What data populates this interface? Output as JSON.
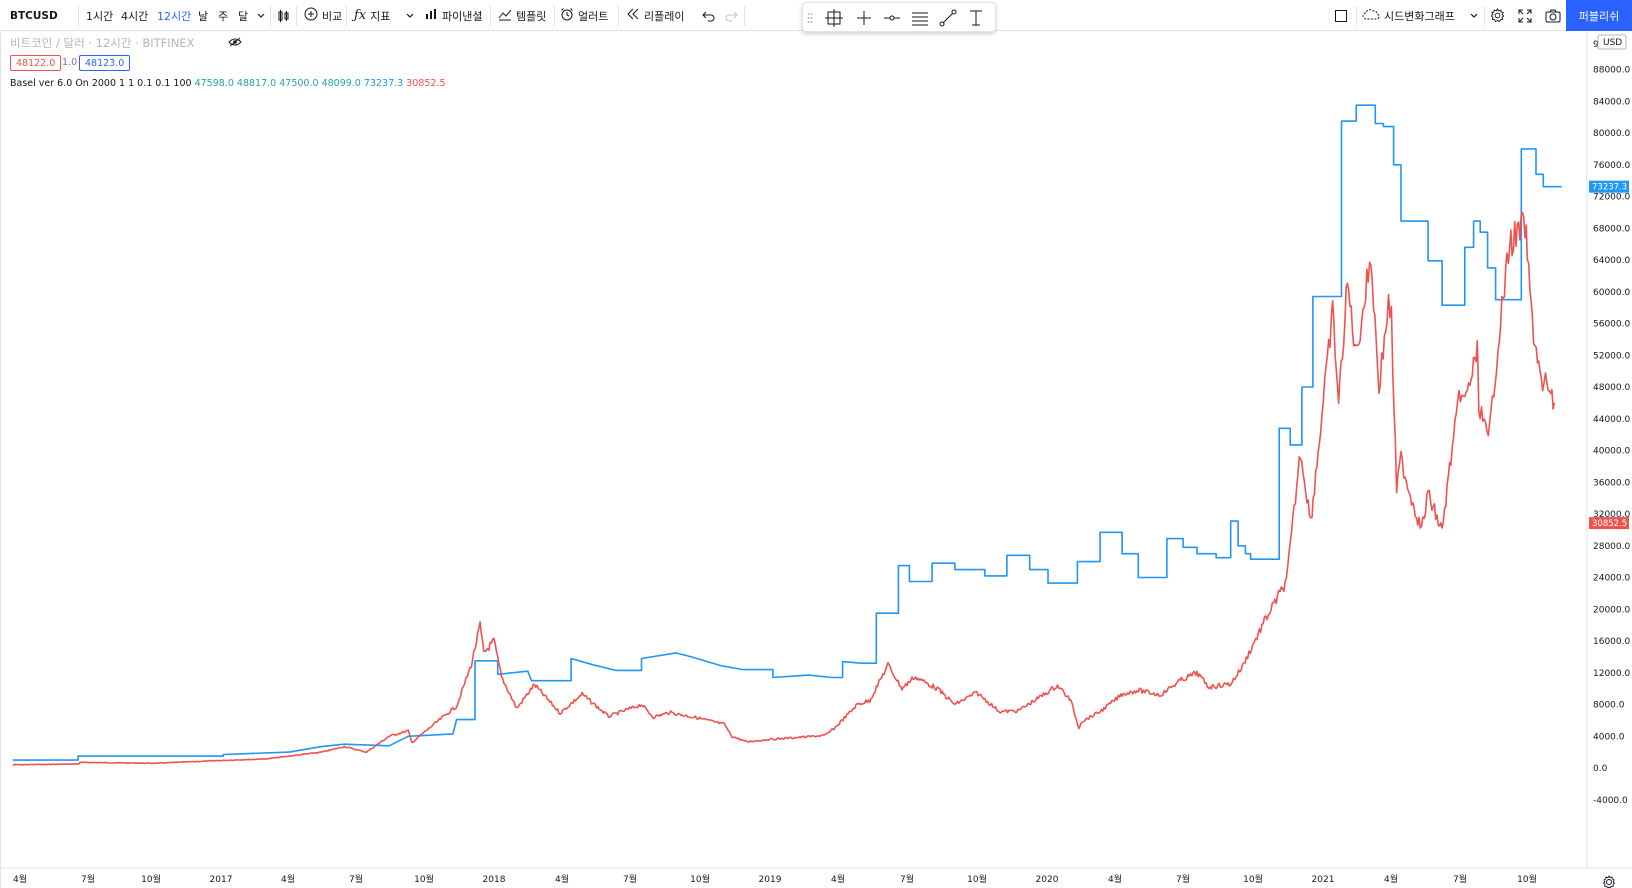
{
  "toolbar": {
    "symbol": "BTCUSD",
    "intervals": [
      "1시간",
      "4시간",
      "12시간",
      "날",
      "주",
      "달"
    ],
    "active_interval": "12시간",
    "compare_label": "비교",
    "indicators_label": "지표",
    "financials_label": "파이낸셜",
    "templates_label": "템플릿",
    "alert_label": "얼러트",
    "replay_label": "리플레이",
    "layout_label": "시드변화그래프",
    "publish_label": "퍼블리쉬"
  },
  "legend": {
    "title": "비트코인 / 달러 · 12시간 · BITFINEX",
    "bid": "48122.0",
    "spread": "1.0",
    "ask": "48123.0"
  },
  "indicator": {
    "name": "Basel ver 6.0 On 2000 1 1 0.1 0.1 100",
    "o": "47598.0",
    "h": "48817.0",
    "l": "47500.0",
    "c": "48099.0",
    "v1": "73237.3",
    "v2": "30852.5"
  },
  "axis": {
    "currency": "USD",
    "top_partial_tick": "9",
    "y_ticks": [
      "88000.0",
      "84000.0",
      "80000.0",
      "76000.0",
      "72000.0",
      "68000.0",
      "64000.0",
      "60000.0",
      "56000.0",
      "52000.0",
      "48000.0",
      "44000.0",
      "40000.0",
      "36000.0",
      "32000.0",
      "28000.0",
      "24000.0",
      "20000.0",
      "16000.0",
      "12000.0",
      "8000.0",
      "4000.0",
      "0.0",
      "-4000.0"
    ],
    "x_ticks": [
      "4월",
      "7월",
      "10월",
      "2017",
      "4월",
      "7월",
      "10월",
      "2018",
      "4월",
      "7월",
      "10월",
      "2019",
      "4월",
      "7월",
      "10월",
      "2020",
      "4월",
      "7월",
      "10월",
      "2021",
      "4월",
      "7월",
      "10월"
    ]
  },
  "labels": {
    "blue_last": "73237.3",
    "red_last": "30852.5"
  },
  "colors": {
    "blue_series": "#2196f3",
    "red_series": "#ef5350",
    "accent": "#2962ff",
    "green_values": "#26a69a"
  },
  "icons": [
    "candles-icon",
    "plus-circle-icon",
    "fx-icon",
    "chart-icon",
    "templates-icon",
    "alarm-icon",
    "replay-icon",
    "undo-icon",
    "redo-icon",
    "square-icon",
    "cloud-icon",
    "gear-icon",
    "fullscreen-icon",
    "camera-icon",
    "eye-off-icon"
  ],
  "chart_data": {
    "type": "line",
    "ylim": [
      -6400,
      93000
    ],
    "x_axis": "time (2016-04 to 2021-12)",
    "series": [
      {
        "color": "#2196f3",
        "shape": "step",
        "points": [
          [
            "2016-03-20",
            1000
          ],
          [
            "2016-06-17",
            1000
          ],
          [
            "2016-06-17",
            1500
          ],
          [
            "2017-01-01",
            1500
          ],
          [
            "2017-01-01",
            1700
          ],
          [
            "2017-04-01",
            2000
          ],
          [
            "2017-05-15",
            2700
          ],
          [
            "2017-06-15",
            3000
          ],
          [
            "2017-08-15",
            2800
          ],
          [
            "2017-09-10",
            4000
          ],
          [
            "2017-11-10",
            4300
          ],
          [
            "2017-11-15",
            6100
          ],
          [
            "2017-12-10",
            6100
          ],
          [
            "2017-12-10",
            13500
          ],
          [
            "2018-01-10",
            13500
          ],
          [
            "2018-01-10",
            11800
          ],
          [
            "2018-02-20",
            12200
          ],
          [
            "2018-02-25",
            11000
          ],
          [
            "2018-04-20",
            11000
          ],
          [
            "2018-04-20",
            13800
          ],
          [
            "2018-05-20",
            13000
          ],
          [
            "2018-06-20",
            12300
          ],
          [
            "2018-07-25",
            12300
          ],
          [
            "2018-07-25",
            13800
          ],
          [
            "2018-09-10",
            14500
          ],
          [
            "2018-10-01",
            14000
          ],
          [
            "2018-11-10",
            12900
          ],
          [
            "2018-12-10",
            12400
          ],
          [
            "2019-01-20",
            12400
          ],
          [
            "2019-01-20",
            11400
          ],
          [
            "2019-03-10",
            11700
          ],
          [
            "2019-04-10",
            11400
          ],
          [
            "2019-04-25",
            11400
          ],
          [
            "2019-04-25",
            13400
          ],
          [
            "2019-05-20",
            13200
          ],
          [
            "2019-06-10",
            13200
          ],
          [
            "2019-06-10",
            19500
          ],
          [
            "2019-07-10",
            19500
          ],
          [
            "2019-07-10",
            25500
          ],
          [
            "2019-07-25",
            25500
          ],
          [
            "2019-07-25",
            23500
          ],
          [
            "2019-08-25",
            23500
          ],
          [
            "2019-08-25",
            25800
          ],
          [
            "2019-09-25",
            25800
          ],
          [
            "2019-09-25",
            25000
          ],
          [
            "2019-11-05",
            25000
          ],
          [
            "2019-11-05",
            24200
          ],
          [
            "2019-12-05",
            24200
          ],
          [
            "2019-12-05",
            26800
          ],
          [
            "2020-01-05",
            26800
          ],
          [
            "2020-01-05",
            25000
          ],
          [
            "2020-01-30",
            25000
          ],
          [
            "2020-01-30",
            23300
          ],
          [
            "2020-03-10",
            23300
          ],
          [
            "2020-03-10",
            26000
          ],
          [
            "2020-04-10",
            26000
          ],
          [
            "2020-04-10",
            29700
          ],
          [
            "2020-05-10",
            29700
          ],
          [
            "2020-05-10",
            27000
          ],
          [
            "2020-06-01",
            27000
          ],
          [
            "2020-06-01",
            24000
          ],
          [
            "2020-07-10",
            24000
          ],
          [
            "2020-07-10",
            28900
          ],
          [
            "2020-08-01",
            28900
          ],
          [
            "2020-08-01",
            27800
          ],
          [
            "2020-08-20",
            27800
          ],
          [
            "2020-08-20",
            27000
          ],
          [
            "2020-09-15",
            27000
          ],
          [
            "2020-09-15",
            26500
          ],
          [
            "2020-10-05",
            26500
          ],
          [
            "2020-10-05",
            31100
          ],
          [
            "2020-10-15",
            31100
          ],
          [
            "2020-10-15",
            28000
          ],
          [
            "2020-10-25",
            28000
          ],
          [
            "2020-10-25",
            27000
          ],
          [
            "2020-11-01",
            27000
          ],
          [
            "2020-11-01",
            26300
          ],
          [
            "2020-12-10",
            26300
          ],
          [
            "2020-12-10",
            42800
          ],
          [
            "2020-12-25",
            42800
          ],
          [
            "2020-12-25",
            40700
          ],
          [
            "2021-01-10",
            40700
          ],
          [
            "2021-01-10",
            48000
          ],
          [
            "2021-01-25",
            48000
          ],
          [
            "2021-01-25",
            59400
          ],
          [
            "2021-03-05",
            59400
          ],
          [
            "2021-03-05",
            81500
          ],
          [
            "2021-03-25",
            81500
          ],
          [
            "2021-03-25",
            83500
          ],
          [
            "2021-04-20",
            83500
          ],
          [
            "2021-04-20",
            81200
          ],
          [
            "2021-05-01",
            81200
          ],
          [
            "2021-05-01",
            80800
          ],
          [
            "2021-05-15",
            80800
          ],
          [
            "2021-05-15",
            76000
          ],
          [
            "2021-05-25",
            76000
          ],
          [
            "2021-05-25",
            68900
          ],
          [
            "2021-07-01",
            68900
          ],
          [
            "2021-07-01",
            63900
          ],
          [
            "2021-07-20",
            63900
          ],
          [
            "2021-07-20",
            58300
          ],
          [
            "2021-08-20",
            58300
          ],
          [
            "2021-08-20",
            65600
          ],
          [
            "2021-09-01",
            65600
          ],
          [
            "2021-09-01",
            68900
          ],
          [
            "2021-09-10",
            68900
          ],
          [
            "2021-09-10",
            67500
          ],
          [
            "2021-09-20",
            67500
          ],
          [
            "2021-09-20",
            63000
          ],
          [
            "2021-10-01",
            63000
          ],
          [
            "2021-10-01",
            59000
          ],
          [
            "2021-11-05",
            59000
          ],
          [
            "2021-11-05",
            78000
          ],
          [
            "2021-11-25",
            78000
          ],
          [
            "2021-11-25",
            74800
          ],
          [
            "2021-12-05",
            74800
          ],
          [
            "2021-12-05",
            73237
          ],
          [
            "2021-12-30",
            73237
          ]
        ]
      },
      {
        "color": "#ef5350",
        "shape": "line",
        "points": [
          [
            "2016-03-20",
            400
          ],
          [
            "2016-06-17",
            500
          ],
          [
            "2016-06-20",
            700
          ],
          [
            "2016-10-01",
            600
          ],
          [
            "2016-12-31",
            950
          ],
          [
            "2017-03-01",
            1150
          ],
          [
            "2017-05-15",
            2000
          ],
          [
            "2017-06-15",
            2700
          ],
          [
            "2017-07-15",
            2000
          ],
          [
            "2017-08-15",
            4000
          ],
          [
            "2017-09-10",
            4700
          ],
          [
            "2017-09-15",
            3200
          ],
          [
            "2017-10-15",
            5500
          ],
          [
            "2017-11-15",
            7800
          ],
          [
            "2017-12-05",
            13000
          ],
          [
            "2017-12-17",
            18000
          ],
          [
            "2017-12-22",
            14500
          ],
          [
            "2018-01-05",
            16000
          ],
          [
            "2018-01-15",
            11500
          ],
          [
            "2018-02-05",
            7500
          ],
          [
            "2018-03-01",
            10500
          ],
          [
            "2018-04-05",
            6900
          ],
          [
            "2018-05-05",
            9300
          ],
          [
            "2018-06-10",
            6500
          ],
          [
            "2018-07-25",
            8000
          ],
          [
            "2018-08-10",
            6400
          ],
          [
            "2018-09-01",
            7000
          ],
          [
            "2018-10-10",
            6300
          ],
          [
            "2018-11-15",
            5500
          ],
          [
            "2018-11-25",
            4000
          ],
          [
            "2018-12-15",
            3300
          ],
          [
            "2019-01-15",
            3600
          ],
          [
            "2019-02-15",
            3800
          ],
          [
            "2019-04-01",
            4100
          ],
          [
            "2019-04-15",
            5100
          ],
          [
            "2019-05-15",
            8000
          ],
          [
            "2019-06-01",
            8500
          ],
          [
            "2019-06-26",
            13000
          ],
          [
            "2019-07-15",
            10000
          ],
          [
            "2019-08-01",
            11500
          ],
          [
            "2019-09-01",
            10000
          ],
          [
            "2019-09-25",
            8000
          ],
          [
            "2019-10-25",
            9500
          ],
          [
            "2019-11-25",
            7100
          ],
          [
            "2019-12-20",
            7200
          ],
          [
            "2020-01-15",
            8700
          ],
          [
            "2020-02-12",
            10400
          ],
          [
            "2020-03-01",
            8500
          ],
          [
            "2020-03-12",
            5000
          ],
          [
            "2020-03-15",
            5800
          ],
          [
            "2020-04-10",
            7100
          ],
          [
            "2020-05-10",
            9300
          ],
          [
            "2020-06-01",
            9800
          ],
          [
            "2020-07-01",
            9200
          ],
          [
            "2020-07-28",
            11000
          ],
          [
            "2020-08-20",
            12000
          ],
          [
            "2020-09-05",
            10200
          ],
          [
            "2020-10-05",
            10600
          ],
          [
            "2020-10-21",
            12800
          ],
          [
            "2020-11-20",
            18500
          ],
          [
            "2020-12-20",
            23500
          ],
          [
            "2021-01-08",
            40000
          ],
          [
            "2021-01-22",
            31000
          ],
          [
            "2021-02-08",
            46000
          ],
          [
            "2021-02-21",
            57500
          ],
          [
            "2021-03-01",
            46000
          ],
          [
            "2021-03-13",
            61000
          ],
          [
            "2021-03-25",
            52000
          ],
          [
            "2021-04-14",
            64500
          ],
          [
            "2021-04-25",
            48000
          ],
          [
            "2021-05-08",
            58500
          ],
          [
            "2021-05-12",
            56500
          ],
          [
            "2021-05-19",
            35000
          ],
          [
            "2021-05-25",
            39000
          ],
          [
            "2021-06-05",
            35000
          ],
          [
            "2021-06-22",
            30000
          ],
          [
            "2021-07-01",
            34500
          ],
          [
            "2021-07-20",
            29800
          ],
          [
            "2021-08-01",
            39000
          ],
          [
            "2021-08-14",
            47500
          ],
          [
            "2021-08-20",
            46000
          ],
          [
            "2021-09-06",
            52500
          ],
          [
            "2021-09-08",
            46000
          ],
          [
            "2021-09-21",
            41000
          ],
          [
            "2021-10-06",
            55000
          ],
          [
            "2021-10-20",
            66000
          ],
          [
            "2021-11-10",
            68500
          ],
          [
            "2021-11-20",
            56000
          ],
          [
            "2021-12-04",
            47500
          ],
          [
            "2021-12-10",
            49000
          ],
          [
            "2021-12-15",
            46500
          ],
          [
            "2021-12-20",
            46000
          ]
        ]
      }
    ]
  }
}
